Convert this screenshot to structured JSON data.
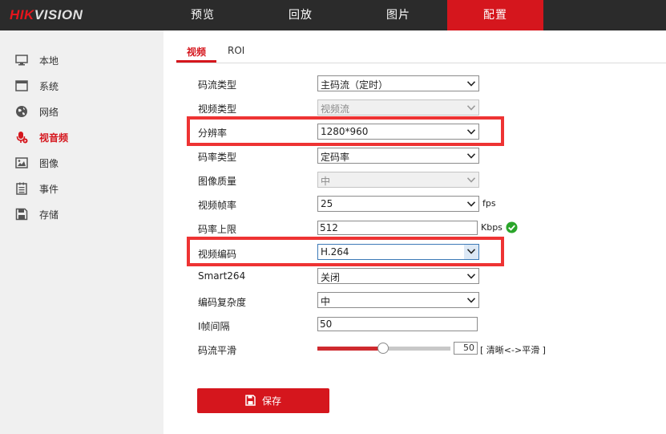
{
  "brand": {
    "hik": "HIK",
    "vision": "VISION"
  },
  "topnav": [
    {
      "label": "预览",
      "active": false
    },
    {
      "label": "回放",
      "active": false
    },
    {
      "label": "图片",
      "active": false
    },
    {
      "label": "配置",
      "active": true
    }
  ],
  "sidebar": {
    "items": [
      {
        "label": "本地",
        "icon": "monitor-icon"
      },
      {
        "label": "系统",
        "icon": "system-window-icon"
      },
      {
        "label": "网络",
        "icon": "globe-icon"
      },
      {
        "label": "视音频",
        "icon": "microphone-icon",
        "active": true
      },
      {
        "label": "图像",
        "icon": "image-icon"
      },
      {
        "label": "事件",
        "icon": "list-icon"
      },
      {
        "label": "存储",
        "icon": "floppy-disk-icon"
      }
    ]
  },
  "subtabs": {
    "video": "视频",
    "roi": "ROI"
  },
  "form": {
    "stream_type": {
      "label": "码流类型",
      "value": "主码流（定时）"
    },
    "video_type": {
      "label": "视频类型",
      "value": "视频流"
    },
    "resolution": {
      "label": "分辨率",
      "value": "1280*960"
    },
    "bitrate_type": {
      "label": "码率类型",
      "value": "定码率"
    },
    "image_quality": {
      "label": "图像质量",
      "value": "中"
    },
    "frame_rate": {
      "label": "视频帧率",
      "value": "25",
      "unit": "fps"
    },
    "max_bitrate": {
      "label": "码率上限",
      "value": "512",
      "unit": "Kbps"
    },
    "video_encoding": {
      "label": "视频编码",
      "value": "H.264"
    },
    "smart264": {
      "label": "Smart264",
      "value": "关闭"
    },
    "encoding_complexity": {
      "label": "编码复杂度",
      "value": "中"
    },
    "i_frame_interval": {
      "label": "I帧间隔",
      "value": "50"
    },
    "stream_smoothing": {
      "label": "码流平滑",
      "value": "50",
      "hint": "[ 清晰<->平滑 ]",
      "fraction": 0.5
    }
  },
  "save_label": "保存",
  "colors": {
    "accent": "#d5161d",
    "topbar": "#2b2b2b",
    "sidebar": "#f0f0f0",
    "highlight": "#ee3333",
    "valid": "#2aa52a"
  }
}
